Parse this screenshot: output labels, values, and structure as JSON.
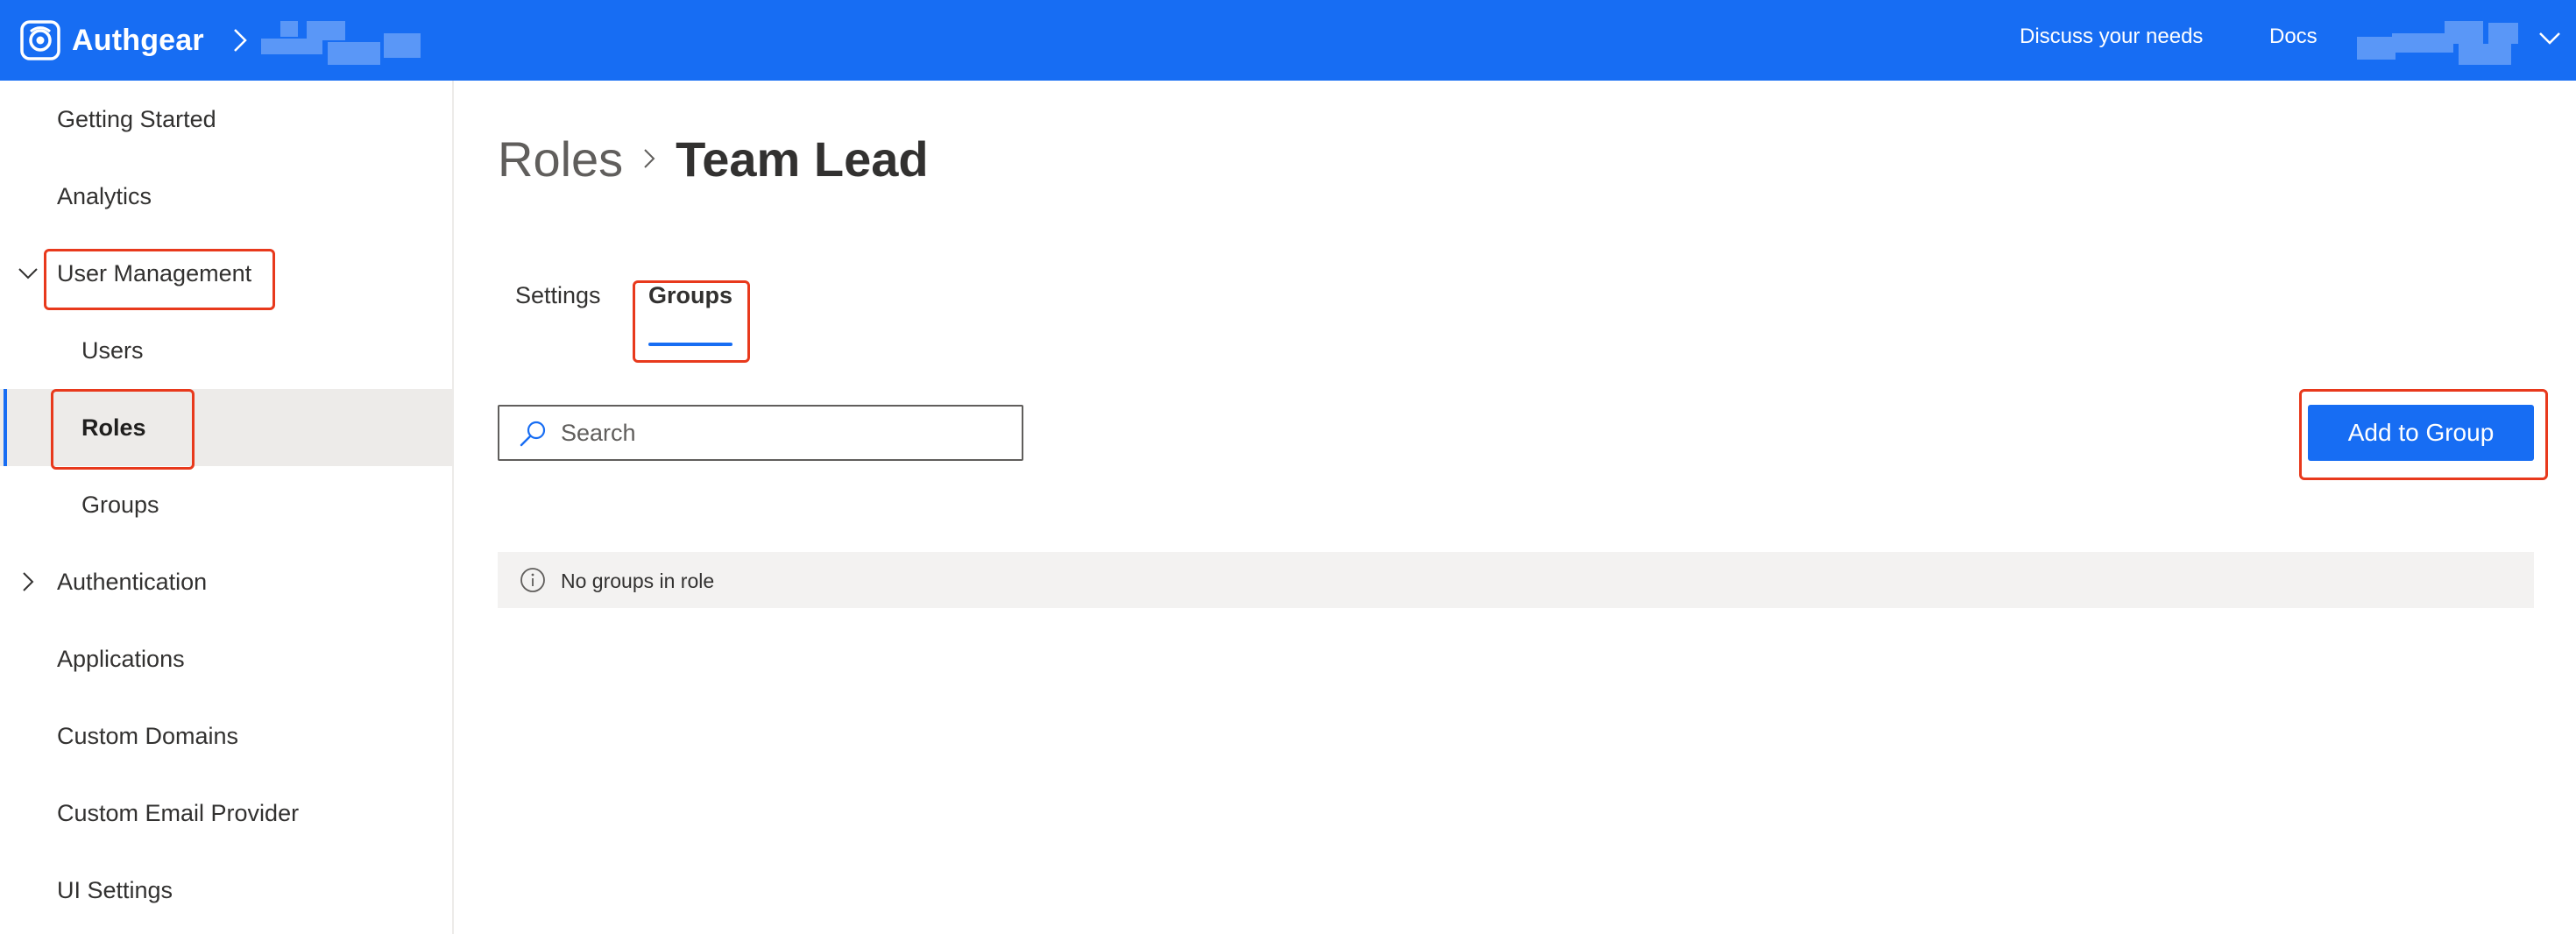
{
  "topbar": {
    "brand_name": "Authgear",
    "links": {
      "discuss": "Discuss your needs",
      "docs": "Docs"
    },
    "icons": {
      "logo": "authgear-logo-icon",
      "separator": "chevron-right-icon",
      "account_menu": "chevron-down-icon"
    }
  },
  "sidebar": {
    "items": [
      {
        "label": "Getting Started"
      },
      {
        "label": "Analytics"
      },
      {
        "label": "User Management",
        "expanded": true,
        "icon": "chevron-down-icon"
      },
      {
        "label": "Users"
      },
      {
        "label": "Roles",
        "active": true
      },
      {
        "label": "Groups"
      },
      {
        "label": "Authentication",
        "expanded": false,
        "icon": "chevron-right-icon"
      },
      {
        "label": "Applications"
      },
      {
        "label": "Custom Domains"
      },
      {
        "label": "Custom Email Provider"
      },
      {
        "label": "UI Settings"
      }
    ]
  },
  "main": {
    "breadcrumb": {
      "parent": "Roles",
      "current": "Team Lead"
    },
    "tabs": [
      {
        "label": "Settings",
        "selected": false
      },
      {
        "label": "Groups",
        "selected": true
      }
    ],
    "search": {
      "placeholder": "Search",
      "value": "",
      "icon": "search-icon"
    },
    "add_button_label": "Add to Group",
    "empty_notice": {
      "text": "No groups in role",
      "icon": "info-icon"
    }
  },
  "colors": {
    "accent": "#176df3",
    "highlight": "#e8391c",
    "active_bg": "#edebe9",
    "notice_bg": "#f3f2f1"
  }
}
